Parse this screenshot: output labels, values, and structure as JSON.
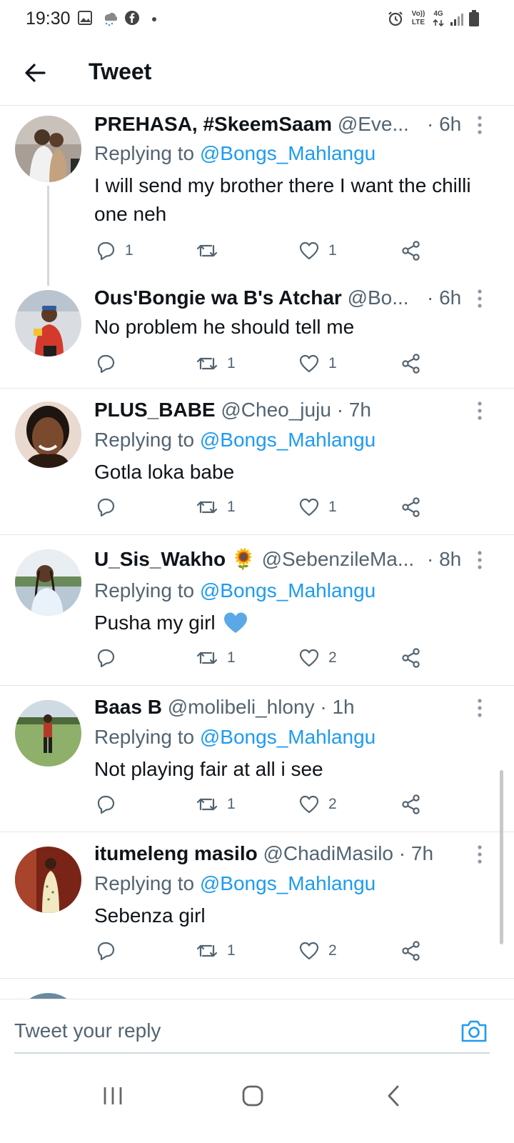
{
  "status_bar": {
    "time": "19:30",
    "net_top": "Vo))",
    "net_bottom": "LTE",
    "net_4g": "4G"
  },
  "header": {
    "title": "Tweet"
  },
  "tweets": [
    {
      "name": "PREHASA, #SkeemSaam",
      "handle": "@Eve...",
      "time": "· 6h",
      "replying_prefix": "Replying to ",
      "mention": "@Bongs_Mahlangu",
      "text": "I will send my brother there I want the chilli one neh",
      "replies": "1",
      "retweets": "",
      "likes": "1",
      "avatar_color": "#8a7f76"
    },
    {
      "name": "Ous'Bongie wa B's Atchar",
      "handle": "@Bo...",
      "time": "· 6h",
      "text": "No problem he should tell me",
      "replies": "",
      "retweets": "1",
      "likes": "1",
      "avatar_color": "#c84a3c"
    },
    {
      "name": "PLUS_BABE",
      "handle": "@Cheo_juju",
      "time": "· 7h",
      "replying_prefix": "Replying to ",
      "mention": "@Bongs_Mahlangu",
      "text": "Gotla loka babe",
      "replies": "",
      "retweets": "1",
      "likes": "1",
      "avatar_color": "#5a3a2a"
    },
    {
      "name": "U_Sis_Wakho",
      "emoji": "🌻",
      "handle": "@SebenzileMa...",
      "time": "· 8h",
      "replying_prefix": "Replying to ",
      "mention": "@Bongs_Mahlangu",
      "text": "Pusha my girl",
      "replies": "",
      "retweets": "1",
      "likes": "2",
      "avatar_color": "#8fa3b5"
    },
    {
      "name": "Baas B",
      "handle": "@molibeli_hlony",
      "time": "· 1h",
      "replying_prefix": "Replying to ",
      "mention": "@Bongs_Mahlangu",
      "text": "Not playing fair at all i see",
      "replies": "",
      "retweets": "1",
      "likes": "2",
      "avatar_color": "#6f9a4a"
    },
    {
      "name": "itumeleng masilo",
      "handle": "@ChadiMasilo",
      "time": "· 7h",
      "replying_prefix": "Replying to ",
      "mention": "@Bongs_Mahlangu",
      "text": "Sebenza girl",
      "replies": "",
      "retweets": "1",
      "likes": "2",
      "avatar_color": "#8b2a1e"
    }
  ],
  "reply_bar": {
    "placeholder": "Tweet your reply"
  },
  "colors": {
    "accent": "#1d9bf0",
    "text": "#0f1419",
    "secondary": "#536471",
    "divider": "#e6e6e6"
  },
  "icons": [
    "back-arrow-icon",
    "reply-icon",
    "retweet-icon",
    "like-icon",
    "share-icon",
    "more-icon",
    "camera-icon",
    "heart-emoji-icon"
  ]
}
